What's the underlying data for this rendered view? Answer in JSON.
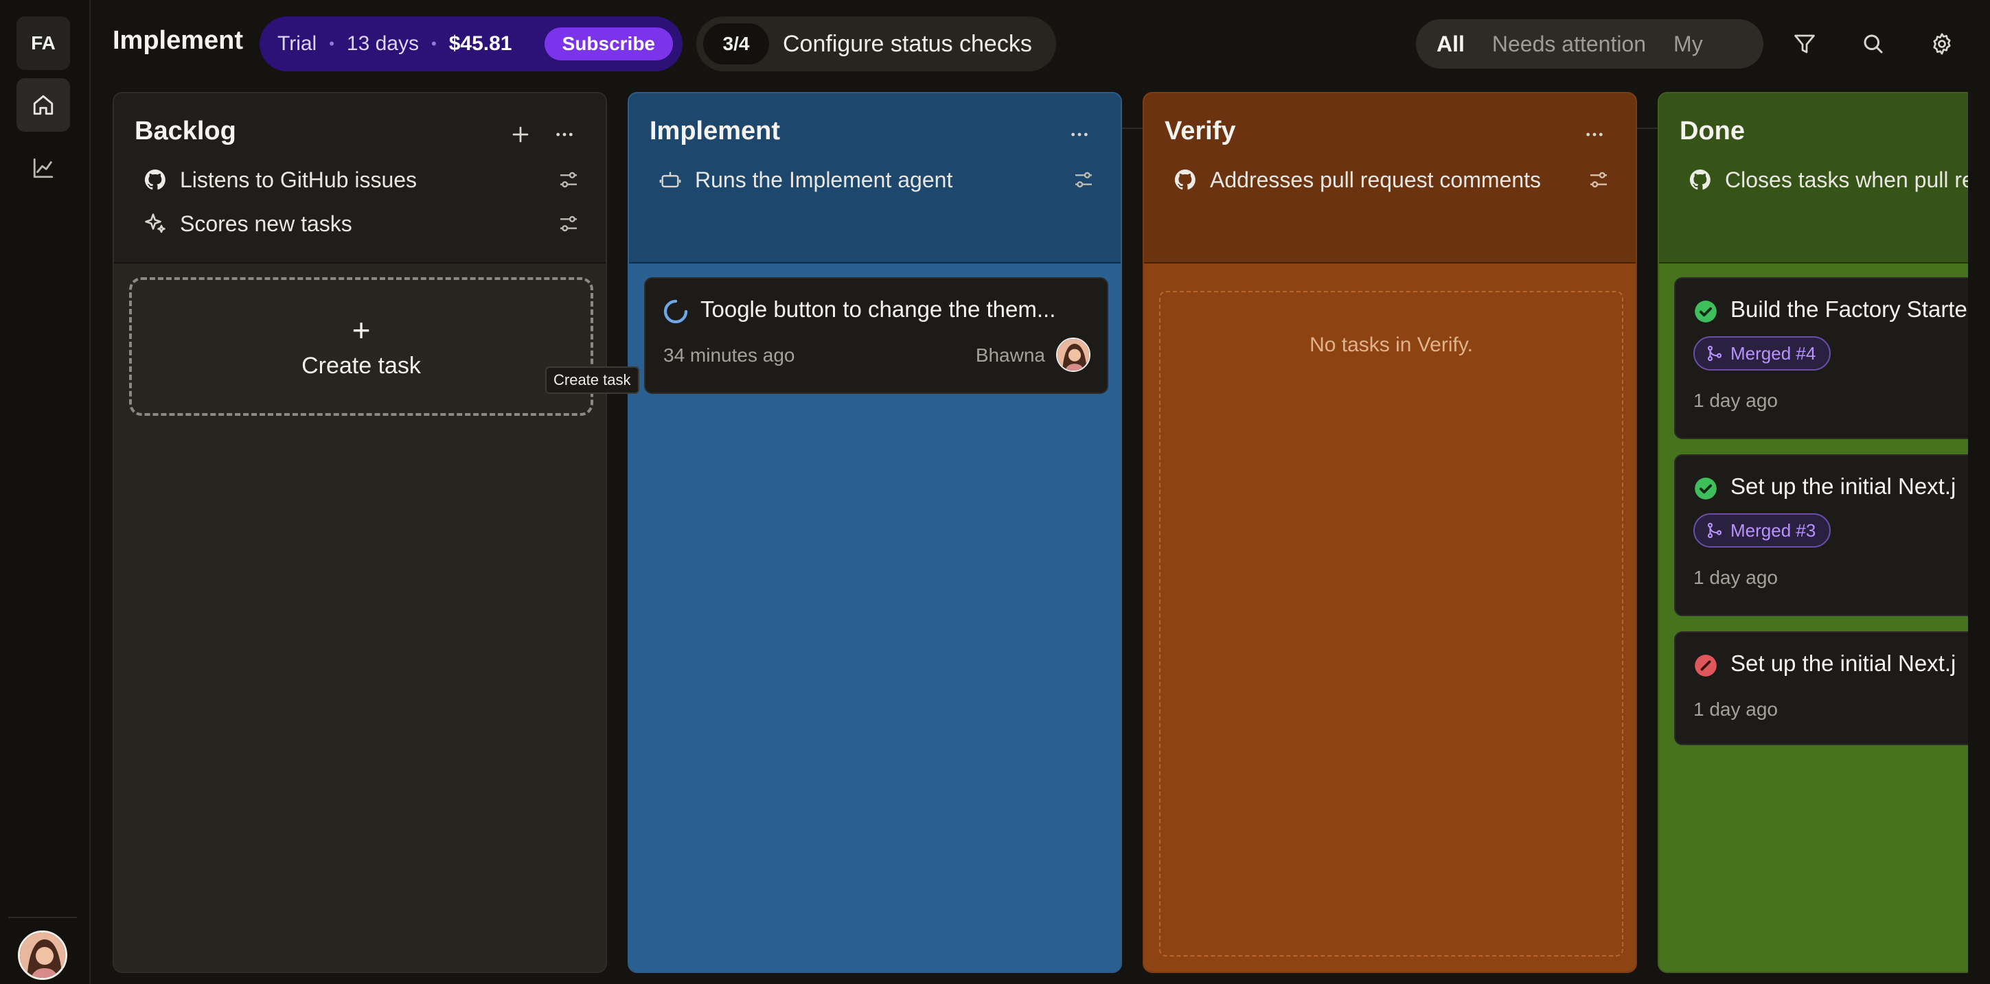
{
  "rail": {
    "workspace": "FA"
  },
  "header": {
    "title": "Implement",
    "trial": {
      "label": "Trial",
      "days": "13 days",
      "amount": "$45.81",
      "subscribe": "Subscribe"
    },
    "checks": {
      "count": "3/4",
      "label": "Configure status checks"
    },
    "filters": [
      "All",
      "Needs attention",
      "My"
    ],
    "active_filter": "All"
  },
  "columns": {
    "backlog": {
      "title": "Backlog",
      "rules": [
        "Listens to GitHub issues",
        "Scores new tasks"
      ],
      "create_label": "Create task",
      "tooltip": "Create task"
    },
    "implement": {
      "title": "Implement",
      "rules": [
        "Runs the Implement agent"
      ],
      "cards": [
        {
          "title": "Toogle button to change the them...",
          "time": "34 minutes ago",
          "user": "Bhawna",
          "state": "running"
        }
      ]
    },
    "verify": {
      "title": "Verify",
      "rules": [
        "Addresses pull request comments"
      ],
      "empty": "No tasks in Verify."
    },
    "done": {
      "title": "Done",
      "rules": [
        "Closes tasks when pull re"
      ],
      "cards": [
        {
          "title": "Build the Factory Starte",
          "badge": "Merged #4",
          "time": "1 day ago",
          "state": "success"
        },
        {
          "title": "Set up the initial Next.j",
          "badge": "Merged #3",
          "time": "1 day ago",
          "state": "success"
        },
        {
          "title": "Set up the initial Next.j",
          "time": "1 day ago",
          "state": "cancelled"
        }
      ]
    }
  },
  "colors": {
    "accent": "#7b34ea",
    "trial_bg": "#2c1277",
    "backlog": "#262520",
    "implement": "#2a5f91",
    "verify": "#8e4313",
    "done": "#47731f",
    "success": "#3fbf5c",
    "cancelled": "#e0575b",
    "merged": "#b892ff"
  }
}
